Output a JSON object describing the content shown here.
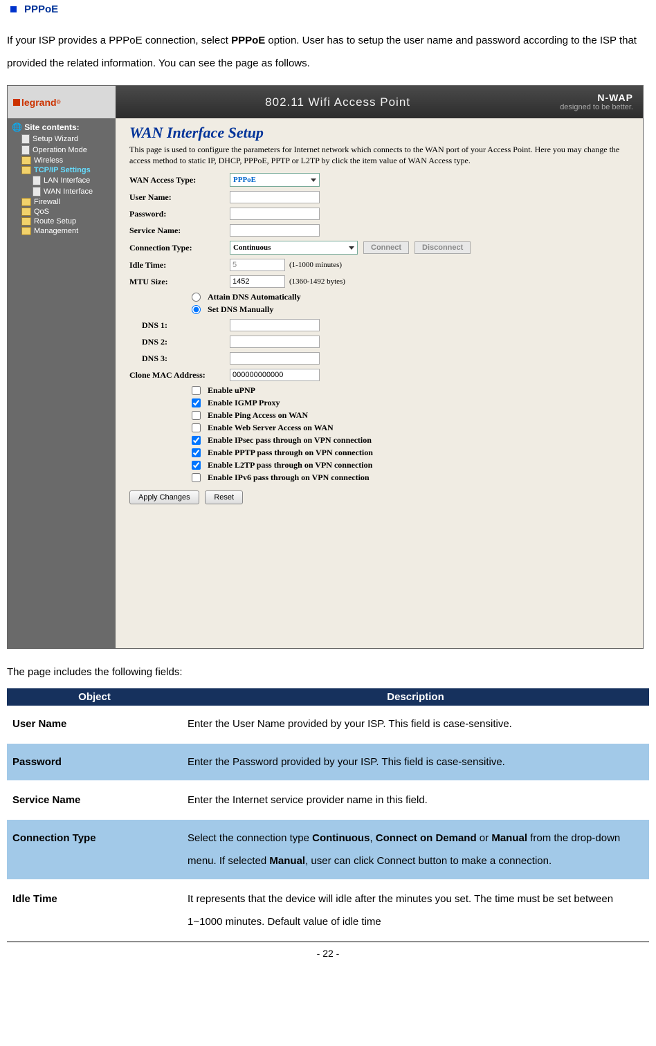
{
  "section_title": "PPPoE",
  "intro_part1": "If your ISP provides a PPPoE connection, select ",
  "intro_bold1": "PPPoE",
  "intro_part2": " option. User has to setup the user name and password according to the ISP that provided the related information. You can see the page as follows.",
  "screenshot": {
    "logo_text": "legrand",
    "header_title": "802.11 Wifi Access Point",
    "brand_top": "N-WAP",
    "brand_sub": "designed to be better.",
    "side_title": "Site contents:",
    "sidebar": {
      "setup_wizard": "Setup Wizard",
      "operation_mode": "Operation Mode",
      "wireless": "Wireless",
      "tcpip": "TCP/IP Settings",
      "lan": "LAN Interface",
      "wan": "WAN Interface",
      "firewall": "Firewall",
      "qos": "QoS",
      "route": "Route Setup",
      "management": "Management"
    },
    "main_title": "WAN Interface Setup",
    "main_desc": "This page is used to configure the parameters for Internet network which connects to the WAN port of your Access Point. Here you may change the access method to static IP, DHCP, PPPoE, PPTP or L2TP by click the item value of WAN Access type.",
    "labels": {
      "wan_access": "WAN Access Type:",
      "user_name": "User Name:",
      "password": "Password:",
      "service_name": "Service Name:",
      "connection_type": "Connection Type:",
      "idle_time": "Idle Time:",
      "mtu": "MTU Size:",
      "dns1": "DNS 1:",
      "dns2": "DNS 2:",
      "dns3": "DNS 3:",
      "clone_mac": "Clone MAC Address:"
    },
    "values": {
      "wan_access": "PPPoE",
      "connection_type": "Continuous",
      "idle_time": "5",
      "mtu": "1452",
      "clone_mac": "000000000000"
    },
    "hints": {
      "idle": "(1-1000 minutes)",
      "mtu": "(1360-1492 bytes)"
    },
    "buttons": {
      "connect": "Connect",
      "disconnect": "Disconnect",
      "apply": "Apply Changes",
      "reset": "Reset"
    },
    "radios": {
      "auto_dns": "Attain DNS Automatically",
      "manual_dns": "Set DNS Manually"
    },
    "checks": {
      "upnp": "Enable uPNP",
      "igmp": "Enable IGMP Proxy",
      "ping": "Enable Ping Access on WAN",
      "web": "Enable Web Server Access on WAN",
      "ipsec": "Enable IPsec pass through on VPN connection",
      "pptp": "Enable PPTP pass through on VPN connection",
      "l2tp": "Enable L2TP pass through on VPN connection",
      "ipv6": "Enable IPv6 pass through on VPN connection"
    }
  },
  "after_screenshot": "The page includes the following fields:",
  "table": {
    "head_obj": "Object",
    "head_desc": "Description",
    "rows": {
      "r1_obj": "User Name",
      "r1_desc": "Enter the User Name provided by your ISP. This field is case-sensitive.",
      "r2_obj": "Password",
      "r2_desc": "Enter the Password provided by your ISP. This field is case-sensitive.",
      "r3_obj": "Service Name",
      "r3_desc": "Enter the Internet service provider name in this field.",
      "r4_obj": "Connection Type",
      "r4_desc_p1": "Select the connection type ",
      "r4_b1": "Continuous",
      "r4_p2": ", ",
      "r4_b2": "Connect on Demand",
      "r4_p3": " or ",
      "r4_b3": "Manual",
      "r4_p4": " from the drop-down menu. If selected ",
      "r4_b4": "Manual",
      "r4_p5": ", user can click Connect button to make a connection.",
      "r5_obj": "Idle Time",
      "r5_desc": "It represents that the device will idle after the minutes you set. The time must be set between 1~1000 minutes. Default value of idle time"
    }
  },
  "page_number": "- 22 -"
}
